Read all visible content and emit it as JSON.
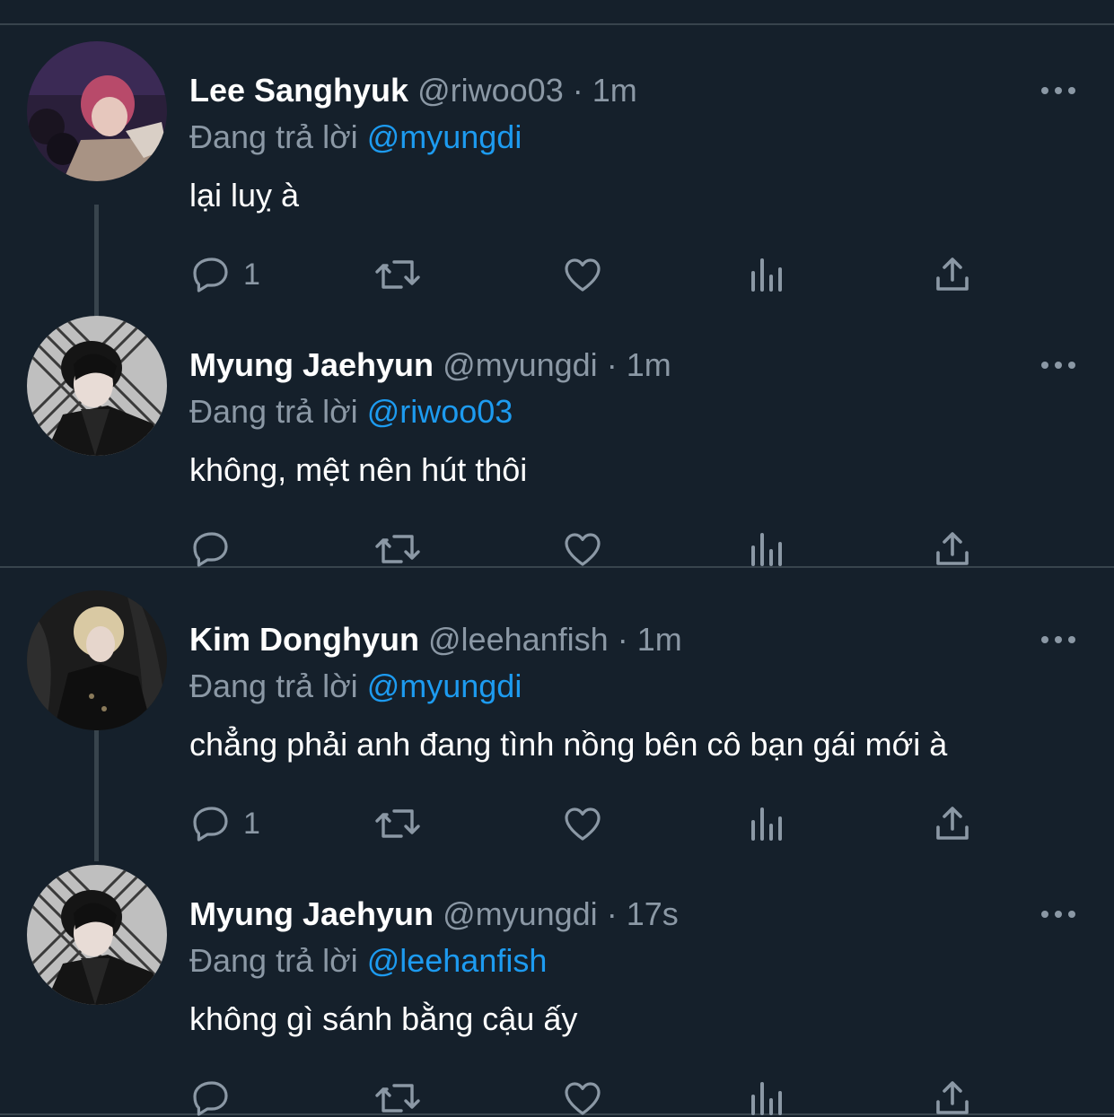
{
  "colors": {
    "background": "#15202b",
    "divider": "#38444d",
    "text_primary": "#ffffff",
    "text_secondary": "#8b98a5",
    "accent": "#1d9bf0"
  },
  "tweets": [
    {
      "name": "Lee Sanghyuk",
      "handle": "@riwoo03",
      "dot": "·",
      "time": "1m",
      "replying_prefix": "Đang trả lời",
      "replying_to": "@myungdi",
      "text": "lại luỵ à",
      "reply_count": "1",
      "avatar_icon": "avatar-photo-pink-hair"
    },
    {
      "name": "Myung Jaehyun",
      "handle": "@myungdi",
      "dot": "·",
      "time": "1m",
      "replying_prefix": "Đang trả lời",
      "replying_to": "@riwoo03",
      "text": "không, mệt nên hút thôi",
      "reply_count": "",
      "avatar_icon": "avatar-photo-dark-hair"
    },
    {
      "name": "Kim Donghyun",
      "handle": "@leehanfish",
      "dot": "·",
      "time": "1m",
      "replying_prefix": "Đang trả lời",
      "replying_to": "@myungdi",
      "text": "chẳng phải anh đang tình nồng bên cô bạn gái mới à",
      "reply_count": "1",
      "avatar_icon": "avatar-photo-blonde-hair"
    },
    {
      "name": "Myung Jaehyun",
      "handle": "@myungdi",
      "dot": "·",
      "time": "17s",
      "replying_prefix": "Đang trả lời",
      "replying_to": "@leehanfish",
      "text": "không gì sánh bằng cậu ấy",
      "reply_count": "",
      "avatar_icon": "avatar-photo-dark-hair"
    }
  ]
}
